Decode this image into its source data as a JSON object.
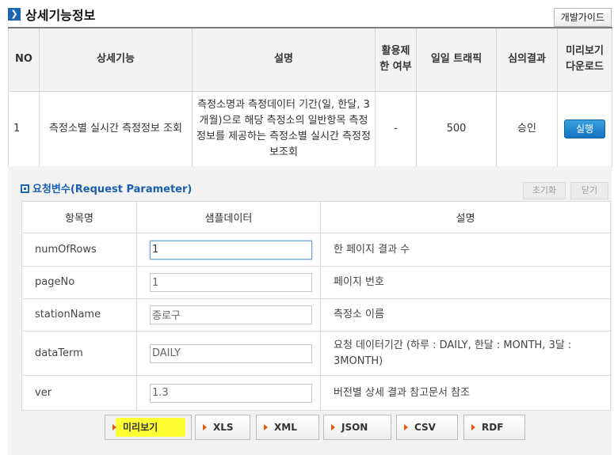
{
  "header": {
    "title": "상세기능정보",
    "guide_button": "개발가이드"
  },
  "info_table": {
    "headers": [
      "NO",
      "상세기능",
      "설명",
      "활용제한 여부",
      "일일 트래픽",
      "심의결과",
      "미리보기 다운로드"
    ],
    "row": {
      "no": "1",
      "feature": "측정소별 실시간 측정정보 조회",
      "description": "측정소명과 측정데이터 기간(일, 한달, 3개월)으로 해당 측정소의 일반항목 측정정보를 제공하는 측정소별 실시간 측정정보조회",
      "restriction": "-",
      "traffic": "500",
      "review": "승인",
      "run_button": "실행"
    }
  },
  "request": {
    "title": "요청변수(Request Parameter)",
    "reset_button": "초기화",
    "close_button": "닫기",
    "headers": [
      "항목명",
      "샘플데이터",
      "설명"
    ],
    "params": [
      {
        "name": "numOfRows",
        "value": "1",
        "desc": "한 페이지 결과 수"
      },
      {
        "name": "pageNo",
        "value": "1",
        "desc": "페이지 번호"
      },
      {
        "name": "stationName",
        "value": "종로구",
        "desc": "측정소 이름"
      },
      {
        "name": "dataTerm",
        "value": "DAILY",
        "desc": "요청 데이터기간 (하루 : DAILY, 한달 : MONTH, 3달 : 3MONTH)"
      },
      {
        "name": "ver",
        "value": "1.3",
        "desc": "버전별 상세 결과 참고문서 참조"
      }
    ]
  },
  "format_buttons": [
    "미리보기",
    "XLS",
    "XML",
    "JSON",
    "CSV",
    "RDF"
  ],
  "colors": {
    "accent": "#1d67b0",
    "run_button": "#1473c2",
    "highlight": "#ffff33",
    "arrow": "#e05a12"
  }
}
